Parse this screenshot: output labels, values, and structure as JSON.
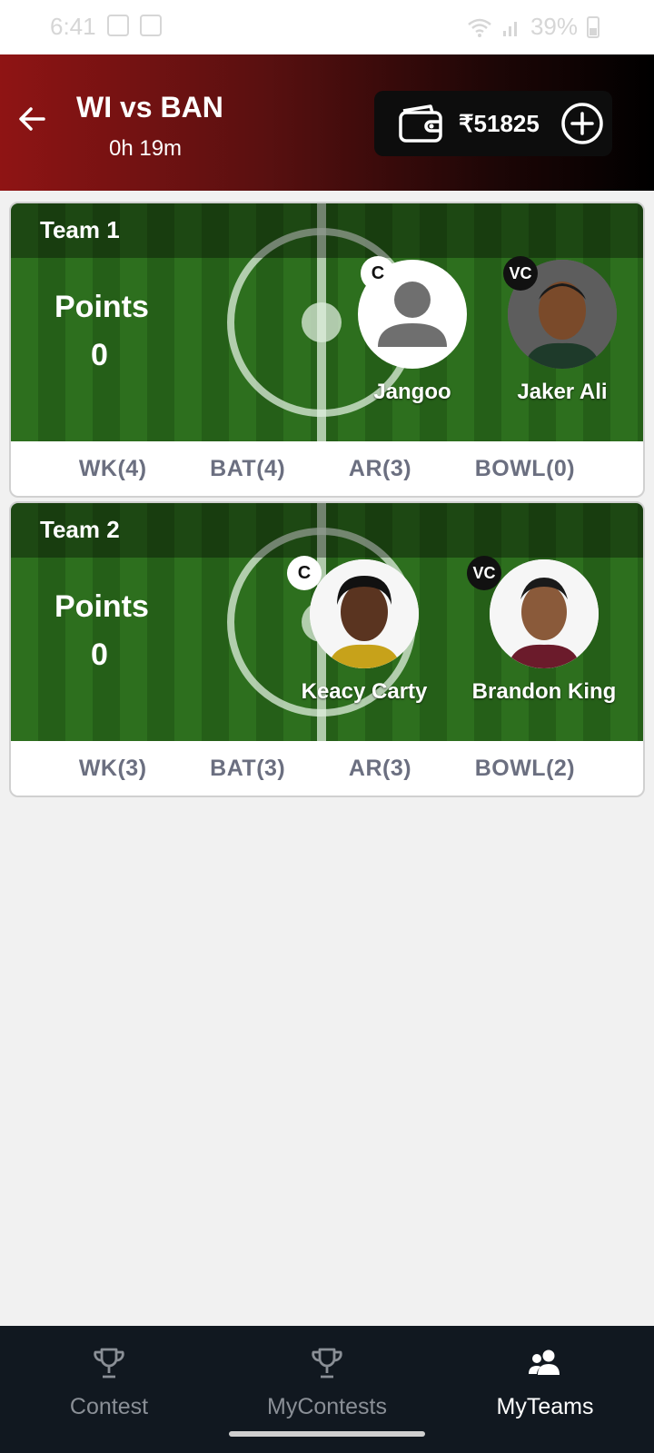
{
  "status_bar": {
    "time": "6:41",
    "battery": "39%"
  },
  "header": {
    "title": "WI vs BAN",
    "countdown": "0h 19m",
    "wallet_amount": "₹51825"
  },
  "teams": [
    {
      "name": "Team 1",
      "points_label": "Points",
      "points": "0",
      "captain": {
        "badge": "C",
        "name": "Jangoo"
      },
      "vice_captain": {
        "badge": "VC",
        "name": "Jaker Ali"
      },
      "roles": [
        "WK(4)",
        "BAT(4)",
        "AR(3)",
        "BOWL(0)"
      ]
    },
    {
      "name": "Team 2",
      "points_label": "Points",
      "points": "0",
      "captain": {
        "badge": "C",
        "name": "Keacy Carty"
      },
      "vice_captain": {
        "badge": "VC",
        "name": "Brandon King"
      },
      "roles": [
        "WK(3)",
        "BAT(3)",
        "AR(3)",
        "BOWL(2)"
      ]
    }
  ],
  "bottom_nav": [
    {
      "label": "Contest",
      "icon": "trophy-icon"
    },
    {
      "label": "MyContests",
      "icon": "trophy-icon"
    },
    {
      "label": "MyTeams",
      "icon": "people-icon",
      "active": true
    }
  ],
  "colors": {
    "header_start": "#8f1414",
    "header_end": "#000000",
    "pitch_green": "#2d6f1e",
    "nav_bg": "#111820"
  }
}
